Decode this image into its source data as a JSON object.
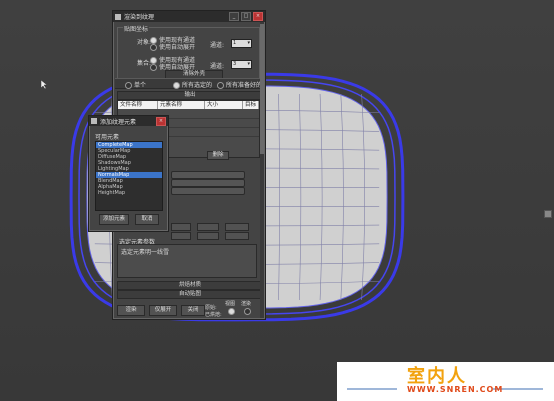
{
  "viewport": {
    "cursor_icon": "arrow-cursor"
  },
  "dialog": {
    "title": "渲染到纹理",
    "title_icon": "app-icon",
    "window_buttons": [
      "_",
      "□",
      "×"
    ],
    "mapping": {
      "group_label": "贴图坐标",
      "object_label": "对象:",
      "object_opt1": "使用现有通道",
      "object_opt2": "使用自动展开",
      "object_channel_label": "通道:",
      "object_channel": "1",
      "subobj_label": "集合:",
      "subobj_opt1": "使用现有通道",
      "subobj_opt2": "使用自动展开",
      "subobj_channel_label": "通道:",
      "subobj_channel": "3",
      "clear_shell": "清除外壳"
    },
    "mode_row": {
      "single": "单个",
      "all_selected": "所有选定的",
      "all_prepared": "所有准备好的"
    },
    "output": {
      "rollout": "输出",
      "columns": [
        "文件名称",
        "元素名称",
        "大小",
        "目标"
      ]
    },
    "popup_hidden_button": "删除",
    "selected_element_label": "选定元素参数",
    "element_notes": "选定元素明一线雪",
    "rollouts": [
      "烘焙材质",
      "自动贴图"
    ],
    "bottom": {
      "render": "渲染",
      "unwrap_only": "仅展开",
      "close": "关闭",
      "original_label": "原始:",
      "baked_label": "已烘焙:",
      "views_label": "视图",
      "render_label": "渲染"
    }
  },
  "popup": {
    "title": "添加纹理元素",
    "list_label": "可用元素",
    "items": [
      "CompleteMap",
      "SpecularMap",
      "DiffuseMap",
      "ShadowsMap",
      "LightingMap",
      "NormalsMap",
      "BlendMap",
      "AlphaMap",
      "HeightMap"
    ],
    "selected": [
      0,
      5
    ],
    "add_button": "添加元素",
    "cancel_button": "取消"
  },
  "watermark": {
    "name": "室内人",
    "url": "WWW.SNREN.COM"
  }
}
